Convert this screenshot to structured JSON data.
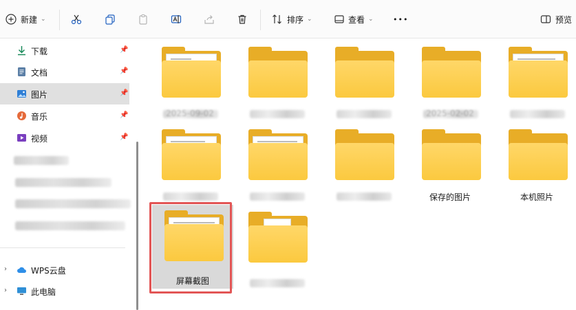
{
  "toolbar": {
    "new_label": "新建",
    "sort_label": "排序",
    "view_label": "查看",
    "more_label": "•••",
    "preview_label": "预览"
  },
  "nav": {
    "quick_access": [
      {
        "label": "下载",
        "icon": "download-icon"
      },
      {
        "label": "文档",
        "icon": "document-icon"
      },
      {
        "label": "图片",
        "icon": "pictures-icon",
        "selected": true
      },
      {
        "label": "音乐",
        "icon": "music-icon"
      },
      {
        "label": "视频",
        "icon": "video-icon"
      }
    ],
    "wps_cloud": "WPS云盘",
    "this_pc": "此电脑"
  },
  "folders": [
    {
      "label": "2025-09-02",
      "blurred": true
    },
    {
      "label": "",
      "blurred": true
    },
    {
      "label": "",
      "blurred": true
    },
    {
      "label": "2025-02-02",
      "blurred": true
    },
    {
      "label": "",
      "blurred": true
    },
    {
      "label": "",
      "blurred": true
    },
    {
      "label": "",
      "blurred": true
    },
    {
      "label": "",
      "blurred": true
    },
    {
      "label": "保存的图片",
      "blurred": false
    },
    {
      "label": "本机照片",
      "blurred": false
    },
    {
      "label": "屏幕截图",
      "blurred": false,
      "selected": true
    },
    {
      "label": "",
      "blurred": true
    }
  ],
  "colors": {
    "folder": "#fbc93f",
    "selection_outline": "#e25555",
    "selected_bg": "#d9d9d9"
  }
}
